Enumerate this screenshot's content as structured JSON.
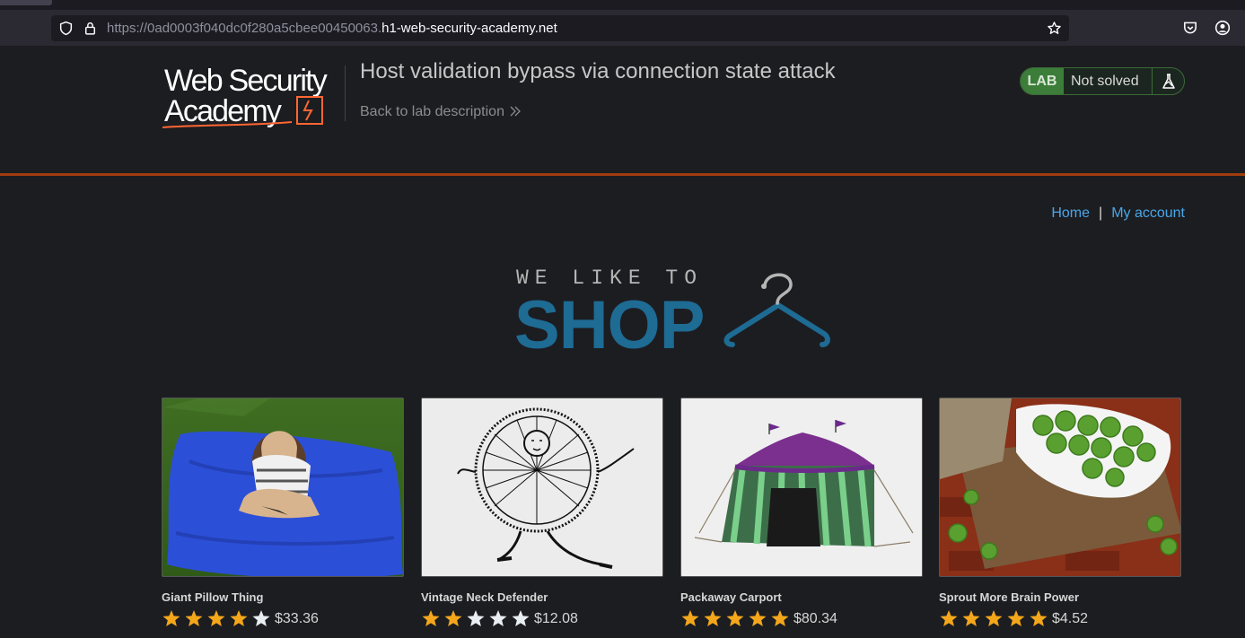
{
  "browser": {
    "url_prefix": "https://0ad0003f040dc0f280a5cbee00450063.",
    "url_host": "h1-web-security-academy.net"
  },
  "lab_header": {
    "logo_line1": "Web Security",
    "logo_line2": "Academy",
    "title": "Host validation bypass via connection state attack",
    "back_link": "Back to lab description",
    "badge_label": "LAB",
    "badge_status": "Not solved"
  },
  "nav": {
    "home": "Home",
    "separator": "|",
    "account": "My account"
  },
  "shop_logo": {
    "line1": "WE LIKE TO",
    "line2": "SHOP"
  },
  "colors": {
    "accent_orange": "#a13c0e",
    "lab_green": "#3c7d3a",
    "link_blue": "#49a6e9",
    "shop_blue": "#1e6b94",
    "star_gold": "#f4a71b"
  },
  "products": [
    {
      "name": "Giant Pillow Thing",
      "rating": 4,
      "price": "$33.36"
    },
    {
      "name": "Vintage Neck Defender",
      "rating": 2,
      "price": "$12.08"
    },
    {
      "name": "Packaway Carport",
      "rating": 5,
      "price": "$80.34"
    },
    {
      "name": "Sprout More Brain Power",
      "rating": 5,
      "price": "$4.52"
    }
  ]
}
